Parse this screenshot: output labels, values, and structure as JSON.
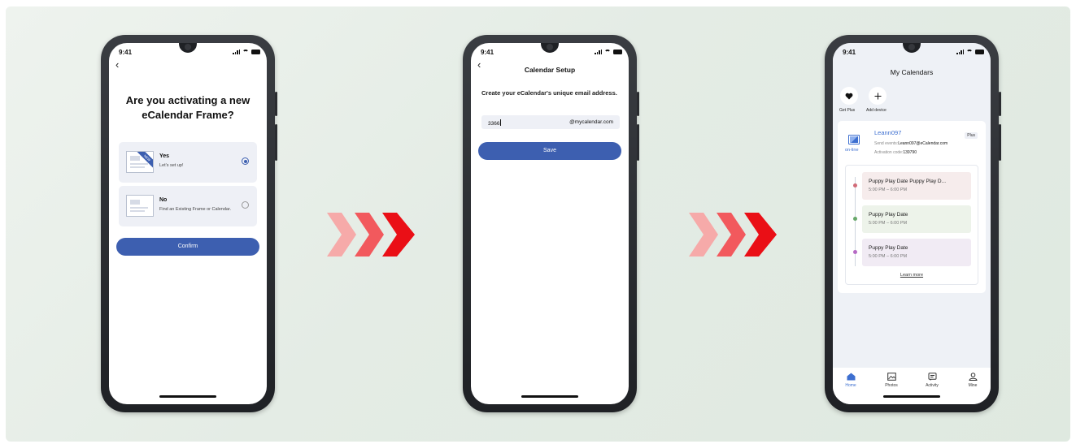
{
  "colors": {
    "accent": "#3d5fb0",
    "arrow_light": "#f6aaa9",
    "arrow_mid": "#f2595d",
    "arrow_dark": "#ea0f16"
  },
  "status_time": "9:41",
  "screen1": {
    "title": "Are you activating a new eCalendar Frame?",
    "options": [
      {
        "title": "Yes",
        "subtitle": "Let's set up!",
        "selected": true,
        "ribbon": "NEW"
      },
      {
        "title": "No",
        "subtitle": "Find an Existing Frame or Calendar.",
        "selected": false
      }
    ],
    "confirm_label": "Confirm"
  },
  "screen2": {
    "title": "Calendar Setup",
    "description": "Create your eCalendar's unique email address.",
    "email_value": "3366",
    "email_domain": "@mycalendar.com",
    "save_label": "Save"
  },
  "screen3": {
    "title": "My Calendars",
    "actions": [
      {
        "label": "Get Plus",
        "icon": "heart-icon"
      },
      {
        "label": "Add device",
        "icon": "plus-icon"
      }
    ],
    "calendar": {
      "name": "Leann097",
      "status": "on-line",
      "badge": "Plus",
      "send_events_label": "Send events:",
      "send_events_value": "Leann097@eCalendar.com",
      "activation_label": "Activation code:",
      "activation_value": "139790"
    },
    "events": [
      {
        "name": "Puppy Play Date Puppy Play D...",
        "time": "5:00 PM – 6:00 PM",
        "color": "#f6ecec",
        "dot": "#d16b78"
      },
      {
        "name": "Puppy Play Date",
        "time": "5:00 PM – 6:00 PM",
        "color": "#edf3ea",
        "dot": "#68a86a"
      },
      {
        "name": "Puppy Play Date",
        "time": "5:00 PM – 6:00 PM",
        "color": "#f1ebf4",
        "dot": "#b569c4"
      }
    ],
    "learn_more": "Learn more",
    "tabs": [
      {
        "label": "Home",
        "icon": "home-icon",
        "active": true
      },
      {
        "label": "Photos",
        "icon": "photos-icon",
        "active": false
      },
      {
        "label": "Activity",
        "icon": "activity-icon",
        "active": false
      },
      {
        "label": "Mine",
        "icon": "mine-icon",
        "active": false
      }
    ]
  }
}
